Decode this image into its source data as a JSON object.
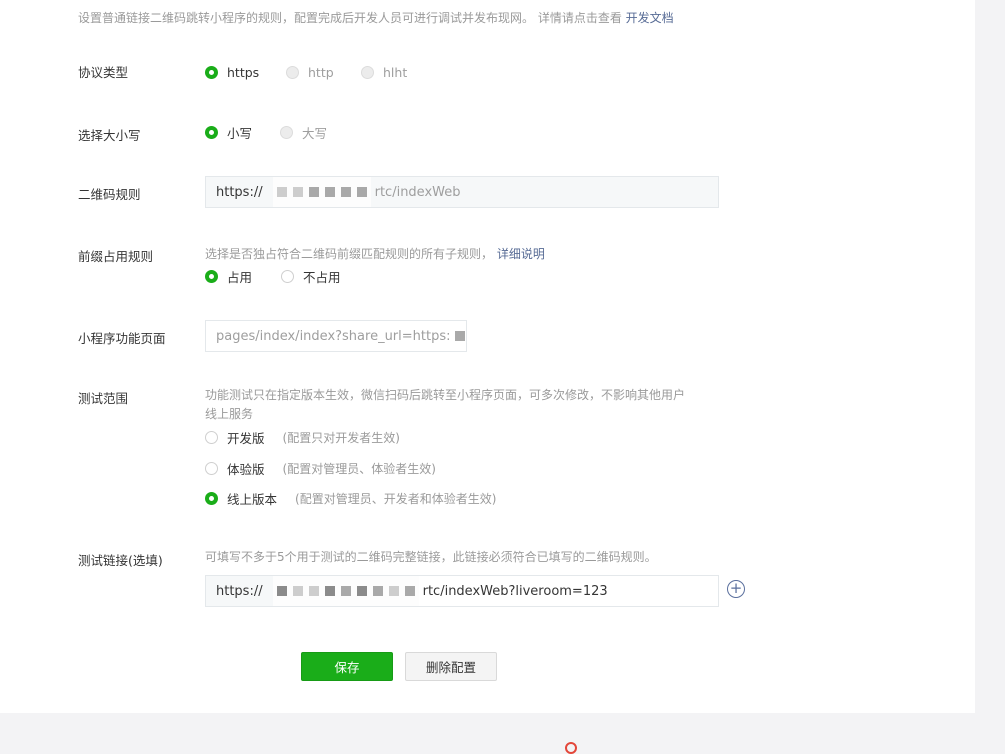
{
  "intro": {
    "text": "设置普通链接二维码跳转小程序的规则，配置完成后开发人员可进行调试并发布现网。 详情请点击查看",
    "link": "开发文档"
  },
  "protocol": {
    "label": "协议类型",
    "options": [
      {
        "label": "https",
        "selected": true
      },
      {
        "label": "http",
        "selected": false
      },
      {
        "label": "hlht",
        "selected": false
      }
    ]
  },
  "case": {
    "label": "选择大小写",
    "options": [
      {
        "label": "小写",
        "selected": true
      },
      {
        "label": "大写",
        "selected": false
      }
    ]
  },
  "qr_rule": {
    "label": "二维码规则",
    "prefix": "https://",
    "value": "rtc/indexWeb"
  },
  "prefix_rule": {
    "label": "前缀占用规则",
    "hint": "选择是否独占符合二维码前缀匹配规则的所有子规则，",
    "hint_link": "详细说明",
    "options": [
      {
        "label": "占用",
        "selected": true
      },
      {
        "label": "不占用",
        "selected": false
      }
    ]
  },
  "page": {
    "label": "小程序功能页面",
    "value": "pages/index/index?share_url=https:"
  },
  "test_scope": {
    "label": "测试范围",
    "hint": "功能测试只在指定版本生效，微信扫码后跳转至小程序页面，可多次修改，不影响其他用户",
    "hint2": "线上服务",
    "options": [
      {
        "label": "开发版",
        "desc": "(配置只对开发者生效)",
        "selected": false
      },
      {
        "label": "体验版",
        "desc": "(配置对管理员、体验者生效)",
        "selected": false
      },
      {
        "label": "线上版本",
        "desc": "(配置对管理员、开发者和体验者生效)",
        "selected": true
      }
    ]
  },
  "test_link": {
    "label": "测试链接(选填)",
    "hint": "可填写不多于5个用于测试的二维码完整链接，此链接必须符合已填写的二维码规则。",
    "prefix": "https://",
    "value": "rtc/indexWeb?liveroom=123",
    "add_icon": "plus-circle-icon"
  },
  "buttons": {
    "save": "保存",
    "delete": "删除配置"
  },
  "colors": {
    "primary": "#1aad19",
    "link": "#576b95"
  }
}
